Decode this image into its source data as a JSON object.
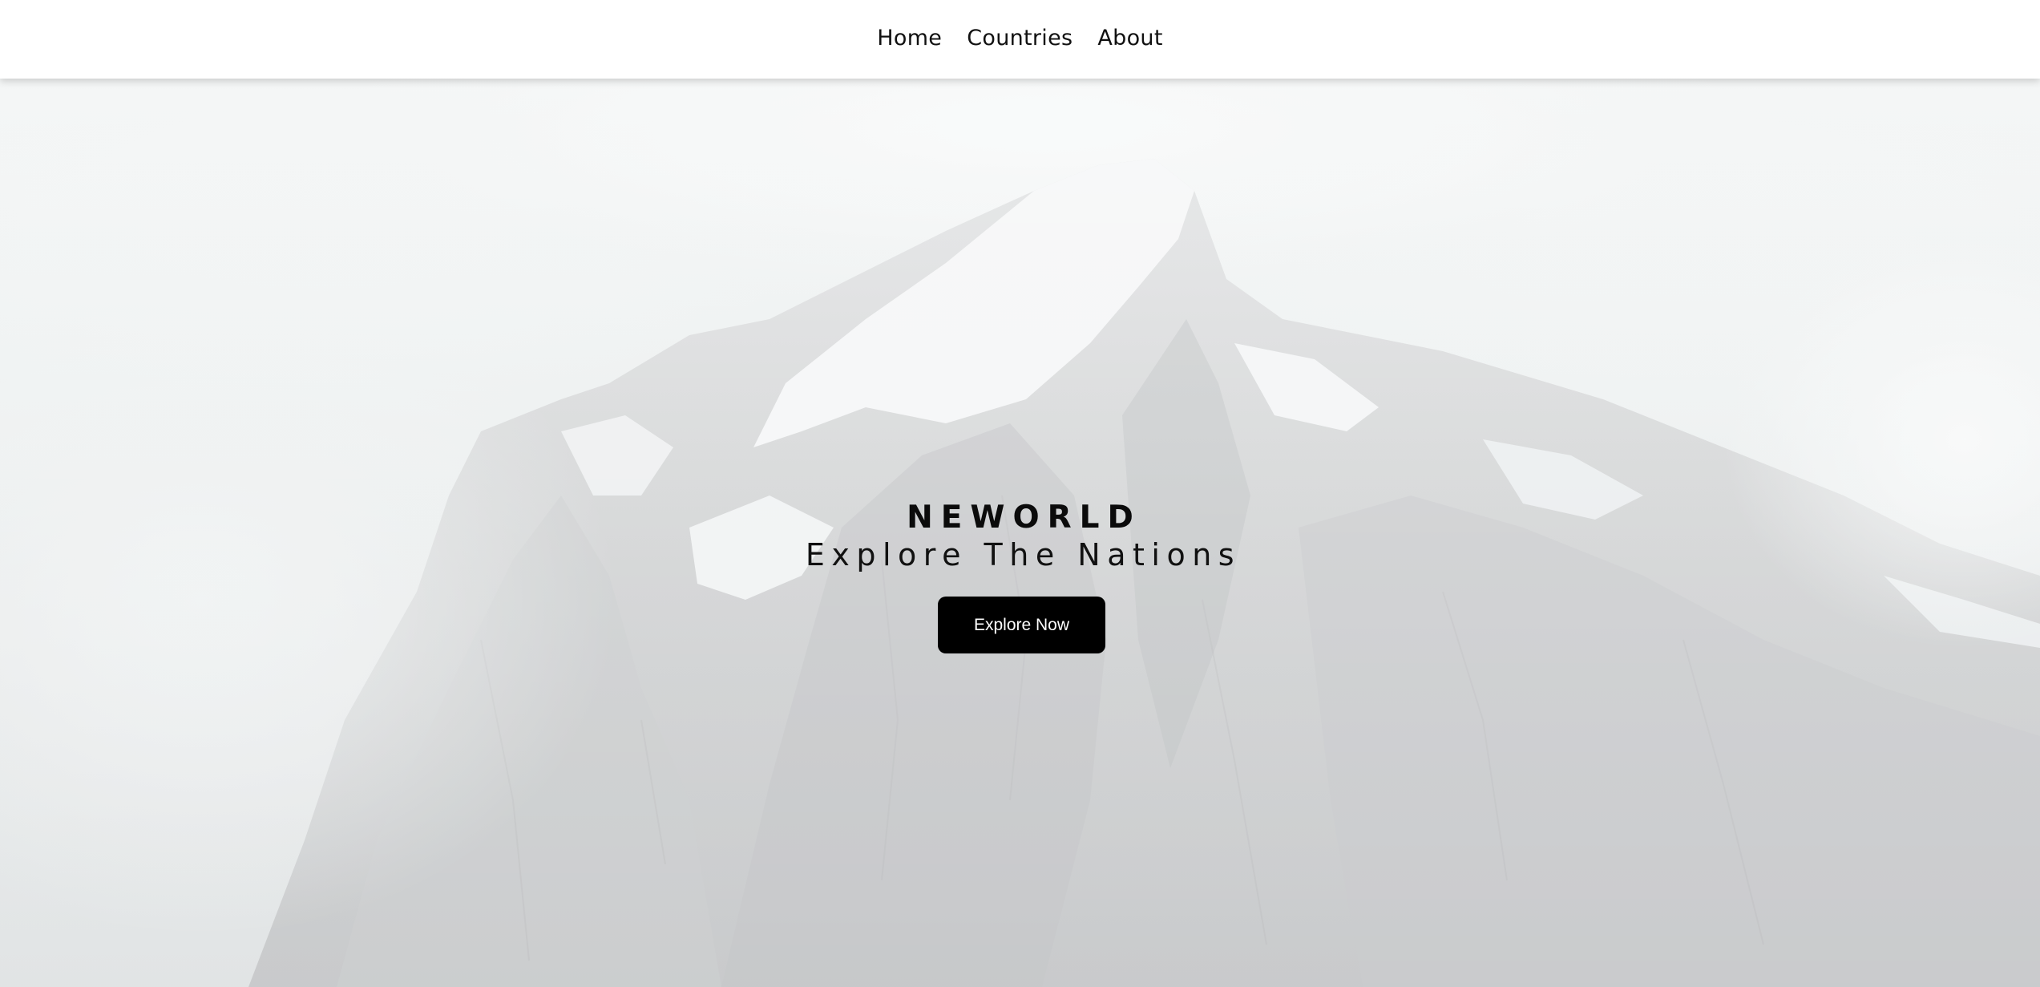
{
  "nav": {
    "items": [
      {
        "label": "Home"
      },
      {
        "label": "Countries"
      },
      {
        "label": "About"
      }
    ]
  },
  "hero": {
    "brand": "NEWORLD",
    "tagline": "Explore The Nations",
    "cta_label": "Explore Now",
    "background": "snow-capped-mountain-photo"
  },
  "colors": {
    "nav_bg": "#ffffff",
    "text": "#111111",
    "button_bg": "#000000",
    "button_text": "#ffffff"
  }
}
